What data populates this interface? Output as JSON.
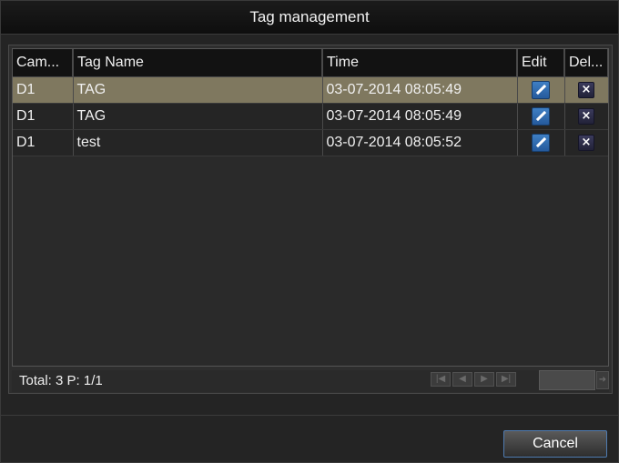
{
  "dialog": {
    "title": "Tag management"
  },
  "table": {
    "columns": [
      "Cam...",
      "Tag Name",
      "Time",
      "Edit",
      "Del..."
    ],
    "rows": [
      {
        "cam": "D1",
        "tag": "TAG",
        "time": "03-07-2014 08:05:49",
        "selected": true
      },
      {
        "cam": "D1",
        "tag": "TAG",
        "time": "03-07-2014 08:05:49",
        "selected": false
      },
      {
        "cam": "D1",
        "tag": "test",
        "time": "03-07-2014 08:05:52",
        "selected": false
      }
    ],
    "edit_icon": "pencil-icon",
    "delete_icon": "close-icon"
  },
  "footer": {
    "total_label": "Total: 3 P: 1/1",
    "pager_icons": [
      "first-page-icon",
      "prev-page-icon",
      "next-page-icon",
      "last-page-icon"
    ],
    "go_icon": "go-arrow-icon"
  },
  "actions": {
    "cancel_label": "Cancel"
  },
  "colors": {
    "selected_row": "#7f785f",
    "edit_button": "#2f6fb5",
    "cancel_border": "#4f7bb0"
  }
}
